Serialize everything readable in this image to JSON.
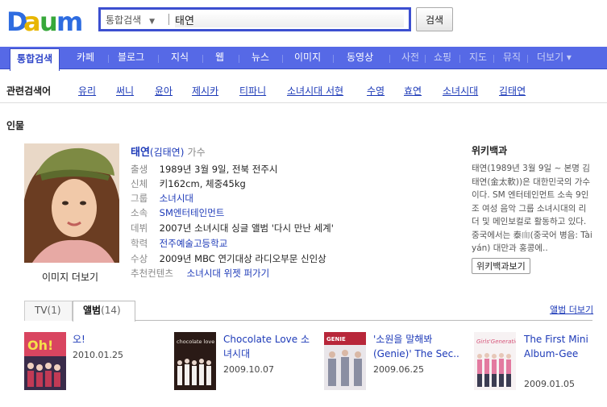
{
  "header": {
    "search": {
      "category": "통합검색",
      "query": "태연"
    },
    "search_button": "검색"
  },
  "tabs": [
    {
      "label": "통합검색",
      "active": true
    },
    {
      "label": "카페"
    },
    {
      "label": "블로그"
    },
    {
      "label": "지식"
    },
    {
      "label": "웹"
    },
    {
      "label": "뉴스"
    },
    {
      "label": "이미지"
    },
    {
      "label": "동영상"
    },
    {
      "label": "사전"
    },
    {
      "label": "쇼핑"
    },
    {
      "label": "지도"
    },
    {
      "label": "뮤직"
    },
    {
      "label": "더보기 ▾"
    }
  ],
  "related": {
    "title": "관련검색어",
    "items": [
      "유리",
      "써니",
      "윤아",
      "제시카",
      "티파니",
      "소녀시대 서현",
      "수영",
      "효연",
      "소녀시대",
      "김태연"
    ]
  },
  "person": {
    "section_title": "인물",
    "name": "태연",
    "hanja": "(김태연)",
    "job": "가수",
    "photo_caption": "이미지 더보기",
    "info": [
      {
        "k": "출생",
        "v": "1989년 3월 9일, 전북 전주시"
      },
      {
        "k": "신체",
        "v": "키162cm, 체중45kg"
      },
      {
        "k": "그룹",
        "v": "소녀시대"
      },
      {
        "k": "소속",
        "v": "SM엔터테인먼트"
      },
      {
        "k": "데뷔",
        "v": "2007년 소녀시대 싱글 앨범 '다시 만난 세계'"
      },
      {
        "k": "학력",
        "v": "전주예술고등학교"
      },
      {
        "k": "수상",
        "v": "2009년 MBC 연기대상 라디오부문 신인상"
      },
      {
        "k": "추천컨텐츠",
        "v": "소녀시대 위젯 퍼가기"
      }
    ]
  },
  "wiki": {
    "title": "위키백과",
    "text": "태연(1989년 3월 9일 ~ 본명 김태연(金太軟))은 대한민국의 가수이다. SM 엔터테인먼트 소속 9인조 여성 음악 그룹 소녀시대의 리더 및 메인보컬로 활동하고 있다. 중국에서는 泰𦓐(중국어 병음: Tàiyán) 대만과 홍콩에..",
    "button": "위키백과보기"
  },
  "subtabs": {
    "tv": {
      "label": "TV",
      "count": "(1)"
    },
    "album": {
      "label": "앨범",
      "count": "(14)"
    },
    "more": "앨범 더보기"
  },
  "albums": [
    {
      "title": "오!",
      "date": "2010.01.25"
    },
    {
      "title": "Chocolate Love 소녀시대",
      "date": "2009.10.07"
    },
    {
      "title": "'소원을 말해봐 (Genie)' The Sec..",
      "date": "2009.06.25"
    },
    {
      "title": "The First Mini Album-Gee",
      "date": "2009.01.05"
    }
  ],
  "colors": {
    "tabbar": "#5669e6",
    "link": "#1d3ab8",
    "search_border": "#3c4fd0"
  }
}
